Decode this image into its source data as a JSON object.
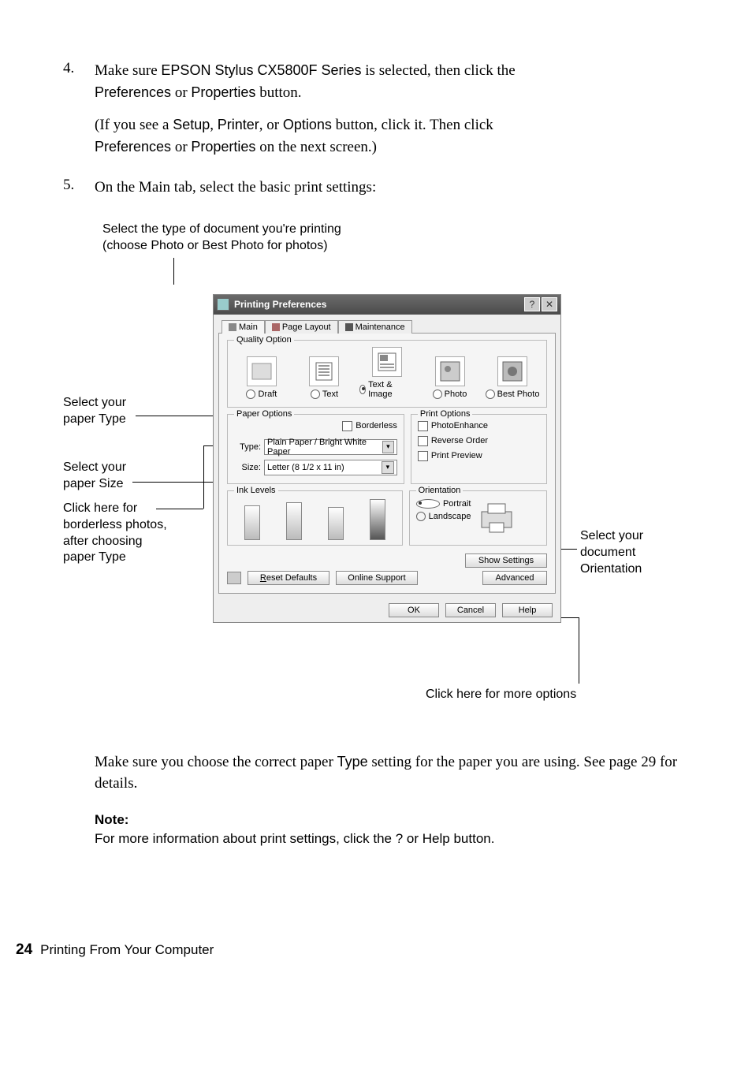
{
  "steps": {
    "s4": {
      "num": "4.",
      "line1a": "Make sure ",
      "line1b": "EPSON Stylus CX5800F Series",
      "line1c": " is selected, then click the ",
      "line2a": "Preferences",
      "line2b": " or ",
      "line2c": "Properties",
      "line2d": " button.",
      "par2a": "(If you see a ",
      "par2b": "Setup",
      "par2c": ", ",
      "par2d": "Printer",
      "par2e": ", or ",
      "par2f": "Options",
      "par2g": " button, click it. Then click ",
      "par2h": "Preferences",
      "par2i": " or ",
      "par2j": "Properties",
      "par2k": " on the next screen.)"
    },
    "s5": {
      "num": "5.",
      "text": "On the Main tab, select the basic print settings:"
    }
  },
  "caption": {
    "l1": "Select the type of document you're printing",
    "l2a": "(choose ",
    "l2b": "Photo",
    "l2c": " or ",
    "l2d": "Best Photo",
    "l2e": " for photos)"
  },
  "callouts": {
    "type": {
      "t1": "Select your",
      "t2a": "paper ",
      "t2b": "Type"
    },
    "size": {
      "t1": "Select your",
      "t2a": "paper ",
      "t2b": "Size"
    },
    "borderless": {
      "l1": "Click here for",
      "l2": "borderless photos,",
      "l3": "after choosing",
      "l4a": "paper ",
      "l4b": "Type"
    },
    "orient": {
      "l1": "Select your",
      "l2": "document",
      "l3": "Orientation"
    },
    "more": "Click here for more options"
  },
  "dialog": {
    "title": "Printing Preferences",
    "tabs": {
      "main": "Main",
      "layout": "Page Layout",
      "maint": "Maintenance"
    },
    "quality": {
      "group": "Quality Option",
      "draft": "Draft",
      "text": "Text",
      "ti": "Text & Image",
      "photo": "Photo",
      "best": "Best Photo"
    },
    "paper": {
      "group": "Paper Options",
      "borderless": "Borderless",
      "type_lbl": "Type:",
      "type_val": "Plain Paper / Bright White Paper",
      "size_lbl": "Size:",
      "size_val": "Letter (8 1/2 x 11 in)"
    },
    "printopts": {
      "group": "Print Options",
      "pe": "PhotoEnhance",
      "ro": "Reverse Order",
      "pp": "Print Preview"
    },
    "ink": "Ink Levels",
    "orient": {
      "group": "Orientation",
      "p": "Portrait",
      "l": "Landscape"
    },
    "buttons": {
      "show": "Show Settings",
      "reset": "Reset Defaults",
      "support": "Online Support",
      "adv": "Advanced",
      "ok": "OK",
      "cancel": "Cancel",
      "help": "Help"
    }
  },
  "aftertext": {
    "p1a": "Make sure you choose the correct paper ",
    "p1b": "Type",
    "p1c": " setting for the paper you are using. See page 29 for details."
  },
  "note": {
    "label": "Note:",
    "t1": "For more information about print settings, click the ",
    "t2": "?",
    "t3": " or ",
    "t4": "Help",
    "t5": " button."
  },
  "footer": {
    "page": "24",
    "title": "Printing From Your Computer"
  }
}
